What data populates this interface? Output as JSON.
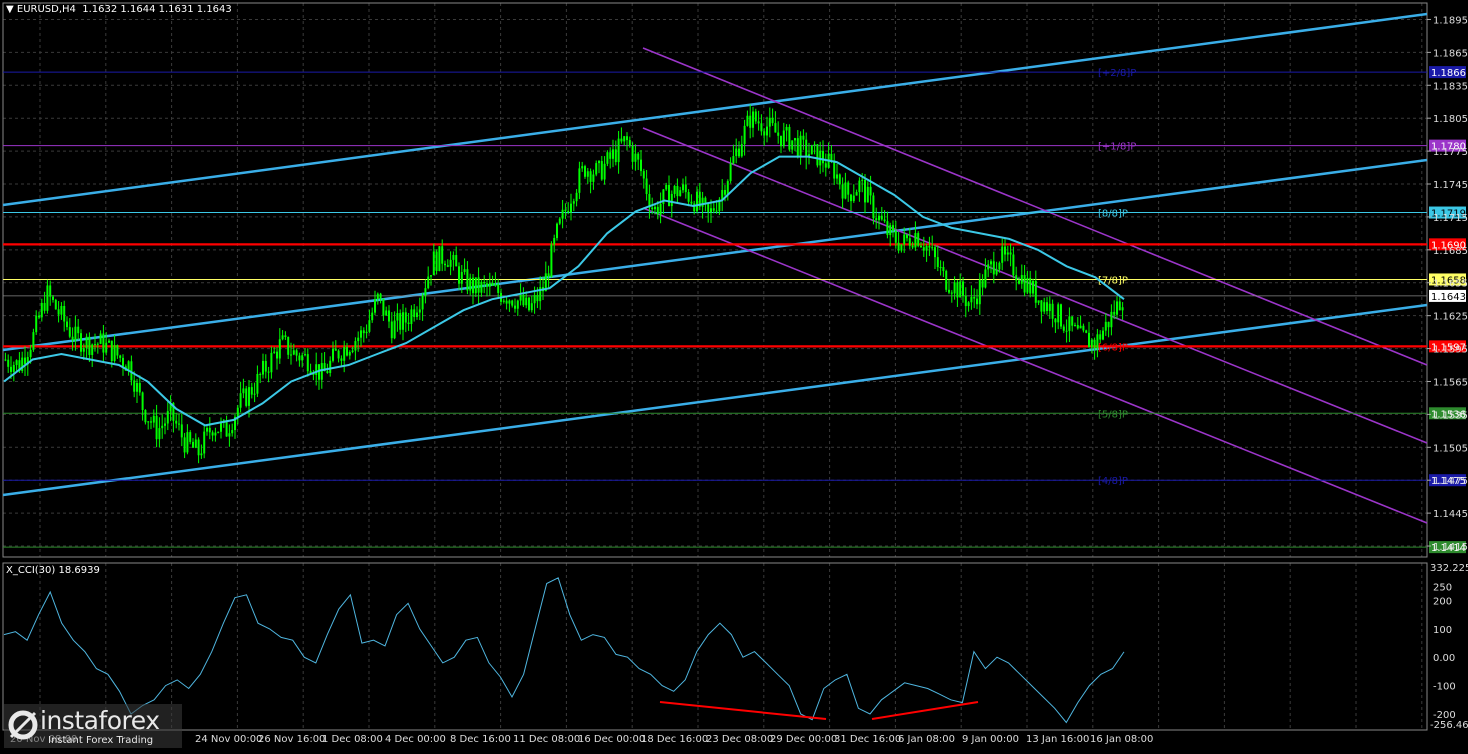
{
  "header": {
    "symbol_label": "EURUSD,H4",
    "ohlc": "1.1632 1.1644 1.1631 1.1643",
    "menu_glyph": "▼"
  },
  "cci_header": {
    "label": "X_CCI(30) 18.6939",
    "max_label": "332.2253",
    "min_label": "-256.464"
  },
  "logo": {
    "brand": "instaforex",
    "tagline": "Instant Forex Trading"
  },
  "colors": {
    "background": "#000000",
    "grid": "#3a3a3a",
    "candle": "#00ff00",
    "ma": "#3cc8e6",
    "channel_blue": "#3aaee8",
    "channel_purple": "#9b35c9",
    "red_level": "#ff0000",
    "cci_line": "#4fb6e0",
    "divergence": "#ff0000"
  },
  "chart_data": [
    {
      "type": "candlestick",
      "title": "EURUSD,H4",
      "ylim": [
        1.1405,
        1.191
      ],
      "y_ticks": [
        "1.1895",
        "1.1865",
        "1.1835",
        "1.1805",
        "1.1775",
        "1.1745",
        "1.1715",
        "1.1685",
        "1.1655",
        "1.1625",
        "1.1595",
        "1.1565",
        "1.1535",
        "1.1505",
        "1.1475",
        "1.1445",
        "1.1415"
      ],
      "x_ticks": [
        "20 Nov 08:00",
        "24 Nov 00:00",
        "26 Nov 16:00",
        "1 Dec 08:00",
        "4 Dec 00:00",
        "8 Dec 16:00",
        "11 Dec 08:00",
        "16 Dec 00:00",
        "18 Dec 16:00",
        "23 Dec 08:00",
        "29 Dec 00:00",
        "31 Dec 16:00",
        "6 Jan 08:00",
        "9 Jan 00:00",
        "13 Jan 16:00",
        "16 Jan 08:00"
      ],
      "close_path": [
        1.1585,
        1.158,
        1.1605,
        1.1645,
        1.1625,
        1.1605,
        1.16,
        1.16,
        1.159,
        1.158,
        1.154,
        1.152,
        1.1535,
        1.151,
        1.15,
        1.1525,
        1.152,
        1.1545,
        1.156,
        1.158,
        1.16,
        1.159,
        1.1585,
        1.157,
        1.159,
        1.16,
        1.161,
        1.164,
        1.1615,
        1.162,
        1.164,
        1.1675,
        1.168,
        1.166,
        1.165,
        1.165,
        1.1645,
        1.164,
        1.163,
        1.165,
        1.17,
        1.1735,
        1.176,
        1.1755,
        1.177,
        1.1785,
        1.176,
        1.172,
        1.1735,
        1.174,
        1.173,
        1.1715,
        1.174,
        1.1775,
        1.1805,
        1.18,
        1.179,
        1.1785,
        1.1775,
        1.177,
        1.176,
        1.1735,
        1.1745,
        1.172,
        1.17,
        1.169,
        1.17,
        1.1685,
        1.166,
        1.165,
        1.1635,
        1.166,
        1.168,
        1.167,
        1.1655,
        1.164,
        1.163,
        1.1615,
        1.1605,
        1.16,
        1.162,
        1.1643
      ],
      "moving_average": [
        1.1565,
        1.1585,
        1.159,
        1.1585,
        1.158,
        1.1565,
        1.154,
        1.1525,
        1.153,
        1.1545,
        1.1565,
        1.1575,
        1.158,
        1.159,
        1.16,
        1.1615,
        1.163,
        1.164,
        1.1645,
        1.165,
        1.167,
        1.17,
        1.172,
        1.173,
        1.1725,
        1.173,
        1.1755,
        1.177,
        1.177,
        1.1765,
        1.175,
        1.1735,
        1.1715,
        1.1705,
        1.17,
        1.1695,
        1.1685,
        1.167,
        1.166,
        1.164
      ],
      "levels": [
        {
          "label": "1.1866",
          "value": 1.1847,
          "color": "#1a1aa8",
          "murrey": "[+2/8]P"
        },
        {
          "label": "1.1780",
          "value": 1.178,
          "color": "#9b35c9",
          "murrey": "[+1/8]P"
        },
        {
          "label": "1.1719",
          "value": 1.1719,
          "color": "#3cc8e6",
          "murrey": "[8/8]P"
        },
        {
          "label": "1.1690",
          "value": 1.169,
          "color": "#ff0000",
          "murrey": ""
        },
        {
          "label": "1.1658",
          "value": 1.1658,
          "color": "#ffff66",
          "murrey": "[7/8]P"
        },
        {
          "label": "1.1643",
          "value": 1.1643,
          "color": "#ffffff",
          "murrey": ""
        },
        {
          "label": "1.1597",
          "value": 1.1597,
          "color": "#ff0000",
          "murrey": "[6/8]P"
        },
        {
          "label": "1.1536",
          "value": 1.1536,
          "color": "#2e8b2e",
          "murrey": "[5/8]P"
        },
        {
          "label": "1.1475",
          "value": 1.1475,
          "color": "#1a1aa8",
          "murrey": "[4/8]P"
        },
        {
          "label": "1.1414",
          "value": 1.1414,
          "color": "#2e8b2e",
          "murrey": ""
        }
      ]
    },
    {
      "type": "line",
      "title": "X_CCI(30) 18.6939",
      "ylim": [
        -256.464,
        332.2253
      ],
      "y_ticks": [
        "250",
        "200",
        "100",
        "0.00",
        "-100",
        "-200"
      ],
      "values": [
        80,
        90,
        60,
        150,
        230,
        120,
        60,
        20,
        -40,
        -60,
        -120,
        -200,
        -170,
        -150,
        -100,
        -80,
        -110,
        -60,
        20,
        120,
        210,
        220,
        120,
        100,
        70,
        60,
        0,
        -20,
        80,
        170,
        220,
        50,
        60,
        40,
        150,
        190,
        100,
        40,
        -20,
        0,
        60,
        70,
        -20,
        -70,
        -140,
        -60,
        100,
        260,
        280,
        150,
        60,
        80,
        70,
        10,
        0,
        -40,
        -60,
        -100,
        -120,
        -80,
        20,
        80,
        120,
        80,
        0,
        20,
        -20,
        -60,
        -100,
        -200,
        -220,
        -110,
        -80,
        -60,
        -180,
        -200,
        -150,
        -120,
        -90,
        -100,
        -110,
        -130,
        -150,
        -160,
        20,
        -40,
        0,
        -20,
        -60,
        -100,
        -140,
        -180,
        -230,
        -160,
        -100,
        -60,
        -40,
        18.69
      ],
      "divergence_lines": 2
    }
  ]
}
